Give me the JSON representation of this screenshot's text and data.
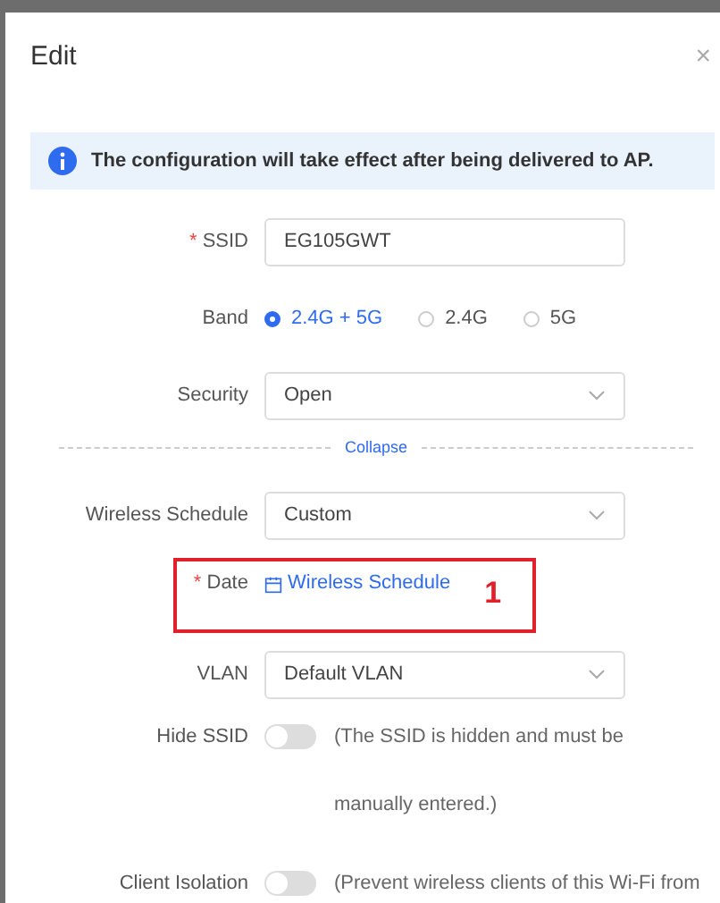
{
  "dialog": {
    "title": "Edit",
    "close": "×"
  },
  "banner": {
    "text": "The configuration will take effect after being delivered to AP."
  },
  "ssid": {
    "mark": "*",
    "label": "SSID",
    "value": "EG105GWT"
  },
  "band": {
    "label": "Band",
    "options": [
      {
        "label": "2.4G + 5G",
        "selected": true
      },
      {
        "label": "2.4G",
        "selected": false
      },
      {
        "label": "5G",
        "selected": false
      }
    ]
  },
  "security": {
    "label": "Security",
    "value": "Open"
  },
  "collapse": "Collapse",
  "schedule": {
    "label": "Wireless Schedule",
    "value": "Custom"
  },
  "date": {
    "mark": "*",
    "label": "Date",
    "link": "Wireless Schedule",
    "annotation": "1"
  },
  "vlan": {
    "label": "VLAN",
    "value": "Default VLAN"
  },
  "toggles": [
    {
      "label": "Hide SSID",
      "on": false,
      "note": "(The SSID is hidden and must be manually entered.)"
    },
    {
      "label": "Client Isolation",
      "on": false,
      "note": "(Prevent wireless clients of this Wi-Fi from"
    }
  ]
}
